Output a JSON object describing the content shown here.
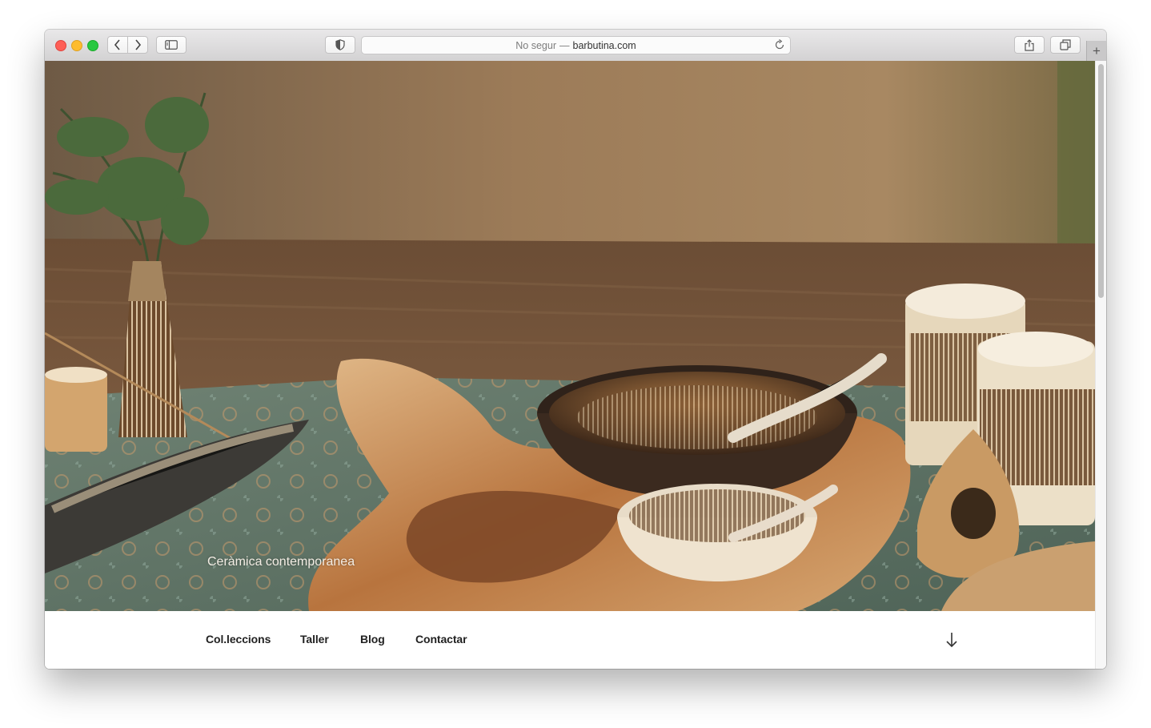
{
  "browser": {
    "address_prefix": "No segur",
    "address_separator": "—",
    "address_domain": "barbutina.com",
    "new_tab_label": "+"
  },
  "hero": {
    "tagline": "Ceràmica contemporanea"
  },
  "nav": {
    "items": [
      {
        "label": "Col.leccions"
      },
      {
        "label": "Taller"
      },
      {
        "label": "Blog"
      },
      {
        "label": "Contactar"
      }
    ],
    "scroll_down_icon": "arrow-down-icon"
  },
  "colors": {
    "traffic_close": "#fe5f57",
    "traffic_minimize": "#febc2e",
    "traffic_zoom": "#28c840",
    "nav_text": "#222222"
  }
}
